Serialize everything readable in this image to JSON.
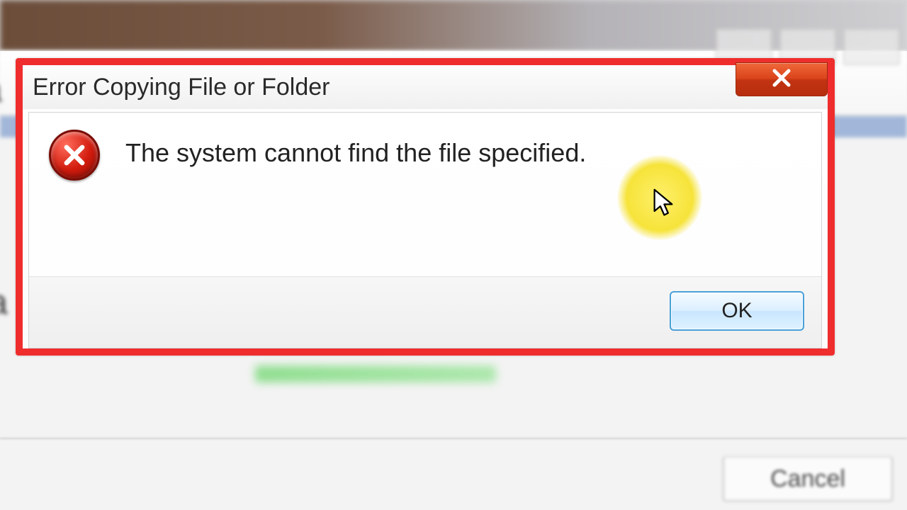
{
  "dialog": {
    "title": "Error Copying File or Folder",
    "message": "The system cannot find the file specified.",
    "ok_label": "OK"
  },
  "background": {
    "cancel_label": "Cancel"
  }
}
